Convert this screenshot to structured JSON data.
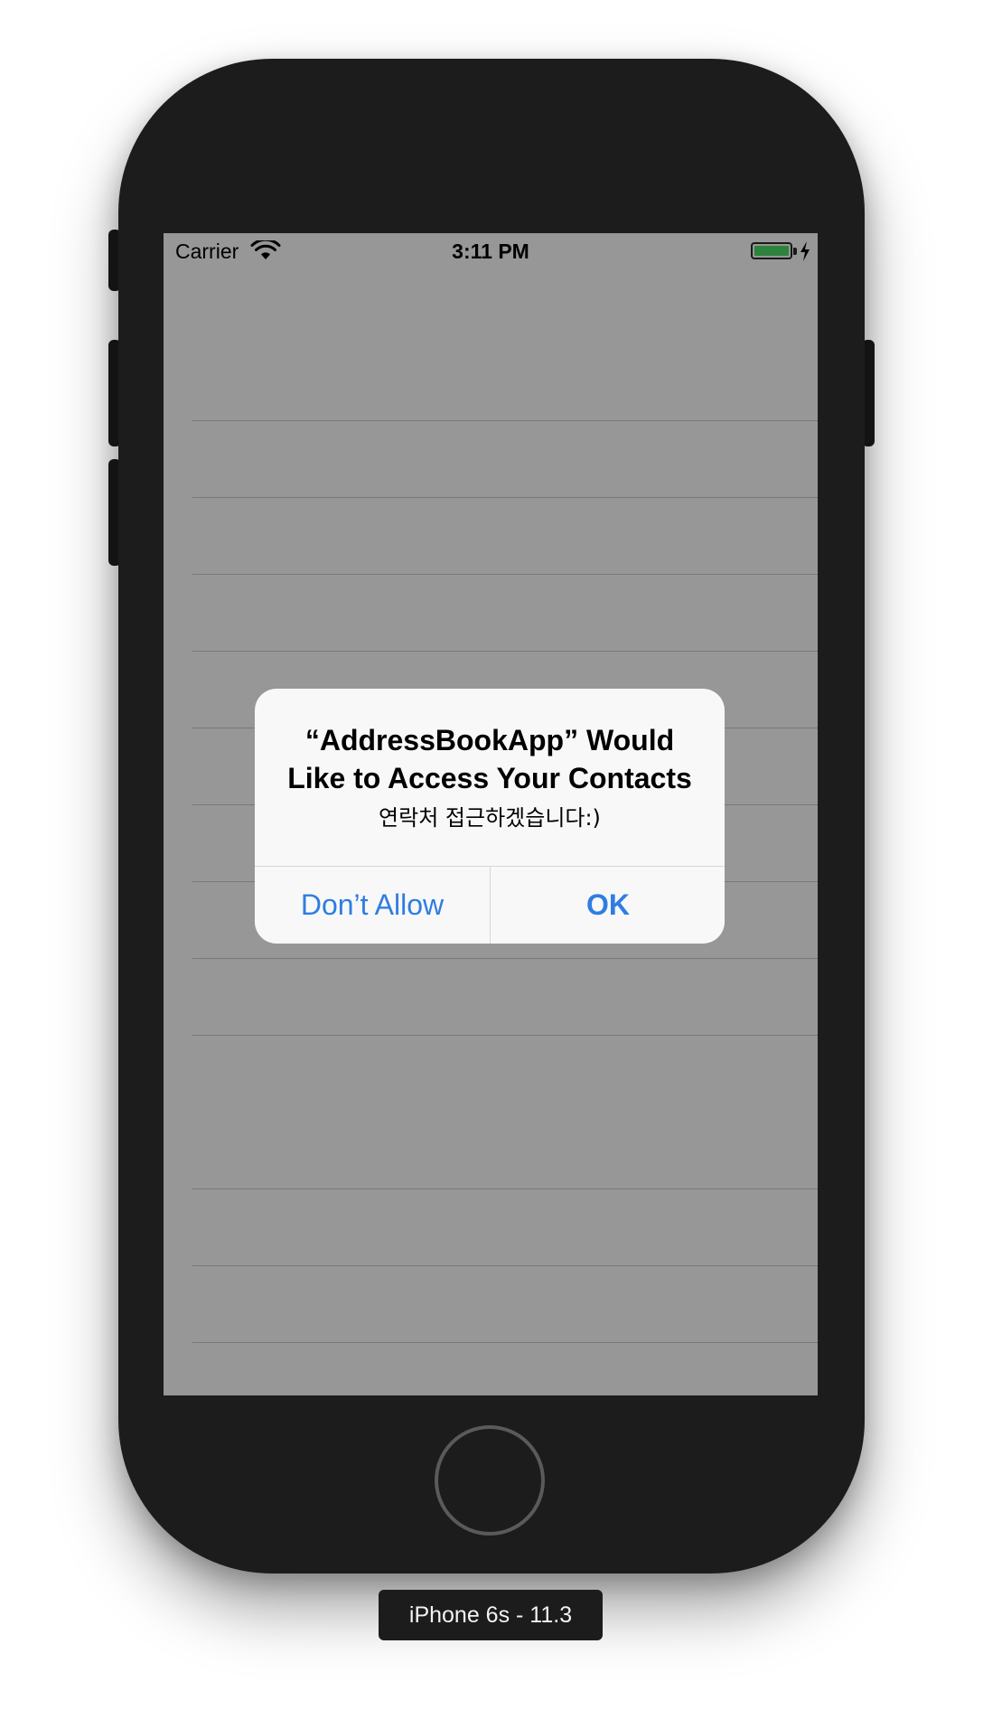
{
  "status_bar": {
    "carrier": "Carrier",
    "time": "3:11 PM",
    "wifi_icon": "wifi-icon",
    "battery_icon": "battery-icon",
    "charging_icon": "charging-bolt-icon",
    "battery_level": 1.0
  },
  "alert": {
    "title": "“AddressBookApp” Would Like to Access Your Contacts",
    "message": "연락처 접근하겠습니다:)",
    "deny_label": "Don’t Allow",
    "ok_label": "OK"
  },
  "device": {
    "label": "iPhone 6s - 11.3"
  },
  "colors": {
    "accent": "#2f7de1",
    "battery": "#4cd964",
    "device_body": "#1c1c1c"
  }
}
